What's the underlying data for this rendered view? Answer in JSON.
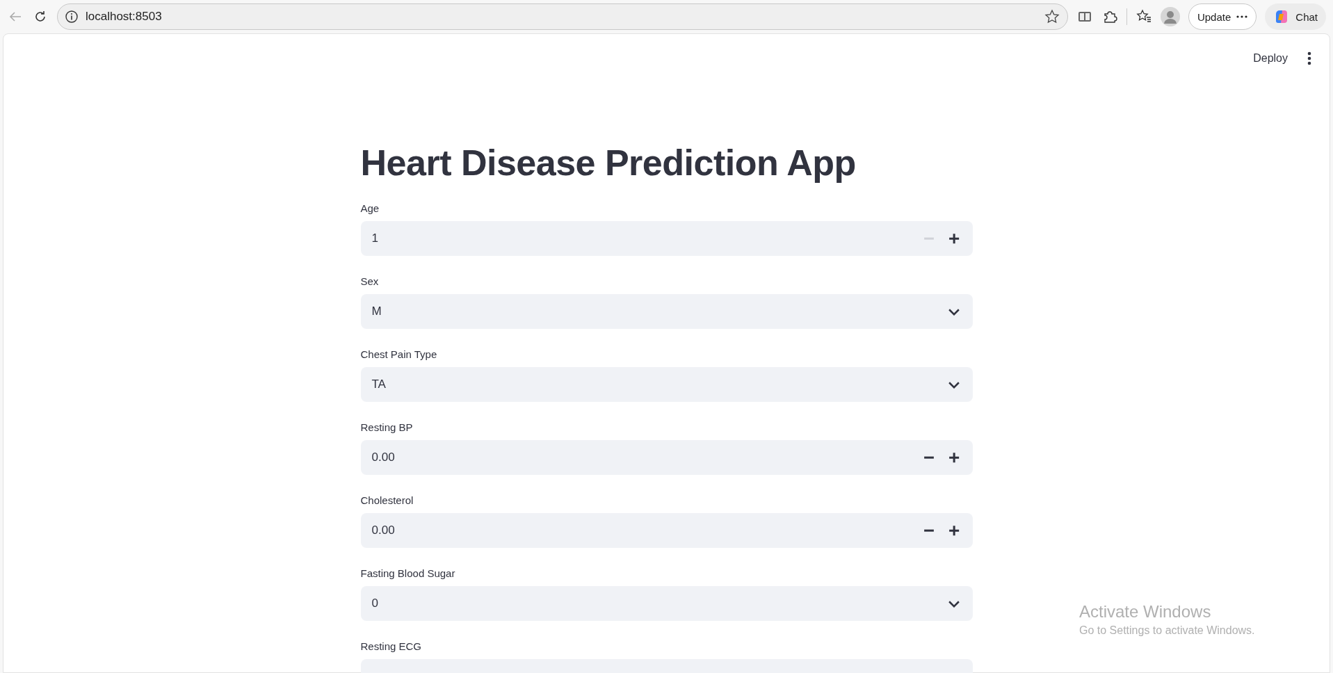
{
  "browser": {
    "url": "localhost:8503",
    "update_label": "Update",
    "chat_label": "Chat"
  },
  "app_header": {
    "deploy_label": "Deploy"
  },
  "title": "Heart Disease Prediction App",
  "fields": [
    {
      "kind": "number",
      "label": "Age",
      "value": "1",
      "minus_disabled": true
    },
    {
      "kind": "select",
      "label": "Sex",
      "value": "M"
    },
    {
      "kind": "select",
      "label": "Chest Pain Type",
      "value": "TA"
    },
    {
      "kind": "number",
      "label": "Resting BP",
      "value": "0.00",
      "minus_disabled": false
    },
    {
      "kind": "number",
      "label": "Cholesterol",
      "value": "0.00",
      "minus_disabled": false
    },
    {
      "kind": "select",
      "label": "Fasting Blood Sugar",
      "value": "0"
    },
    {
      "kind": "select",
      "label": "Resting ECG"
    }
  ],
  "os_notice": {
    "title": "Activate Windows",
    "text": "Go to Settings to activate Windows."
  }
}
